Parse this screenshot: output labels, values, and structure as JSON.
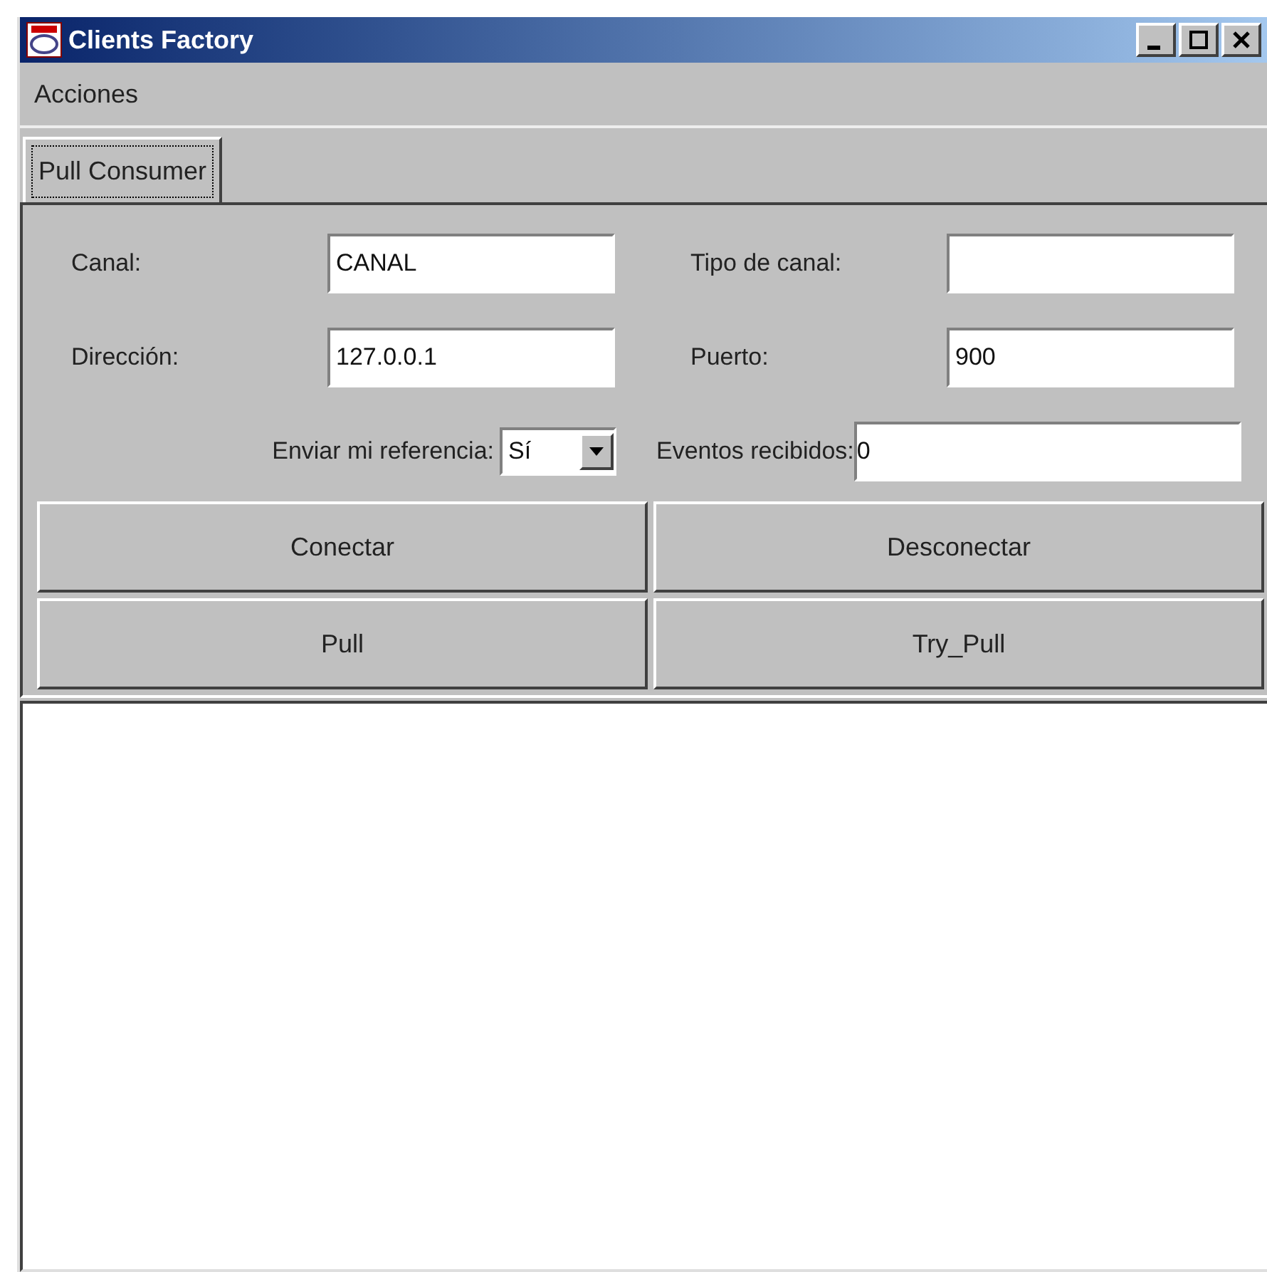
{
  "window": {
    "title": "Clients Factory"
  },
  "menu": [
    "Acciones"
  ],
  "tabs": [
    {
      "label": "Pull Consumer",
      "selected": true
    }
  ],
  "fields": [
    {
      "kind": "text",
      "label": "Canal:",
      "value": "CANAL"
    },
    {
      "kind": "text",
      "label": "Tipo de canal:"
    },
    {
      "kind": "text",
      "label": "Dirección:",
      "value": "127.0.0.1"
    },
    {
      "kind": "text",
      "label": "Puerto:",
      "value": "900"
    },
    {
      "kind": "combo",
      "label": "Enviar mi referencia:",
      "value": "Sí"
    },
    {
      "kind": "inline",
      "label": "Eventos recibidos:",
      "value": "0"
    }
  ],
  "buttons": [
    "Conectar",
    "Desconectar",
    "Pull",
    "Try_Pull"
  ]
}
